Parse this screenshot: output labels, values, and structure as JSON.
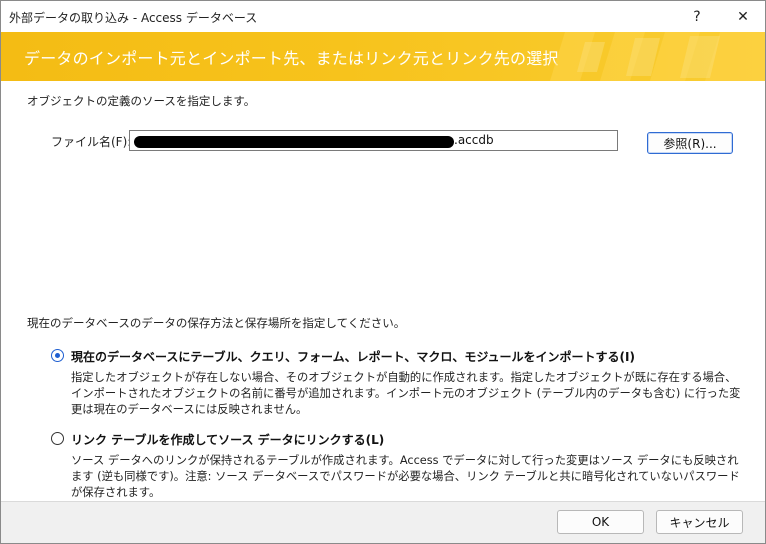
{
  "window": {
    "title": "外部データの取り込み - Access データベース",
    "help_glyph": "?",
    "close_glyph": "✕"
  },
  "banner": {
    "heading": "データのインポート元とインポート先、またはリンク元とリンク先の選択",
    "color": "#f5be17"
  },
  "source": {
    "instruction": "オブジェクトの定義のソースを指定します。",
    "file_label": "ファイル名(F):",
    "file_value_visible_suffix": ".accdb",
    "browse_label": "参照(R)..."
  },
  "storage": {
    "instruction": "現在のデータベースのデータの保存方法と保存場所を指定してください。",
    "options": [
      {
        "label": "現在のデータベースにテーブル、クエリ、フォーム、レポート、マクロ、モジュールをインポートする(I)",
        "description": "指定したオブジェクトが存在しない場合、そのオブジェクトが自動的に作成されます。指定したオブジェクトが既に存在する場合、インポートされたオブジェクトの名前に番号が追加されます。インポート元のオブジェクト (テーブル内のデータも含む) に行った変更は現在のデータベースには反映されません。",
        "selected": true
      },
      {
        "label": "リンク テーブルを作成してソース データにリンクする(L)",
        "description": "ソース データへのリンクが保持されるテーブルが作成されます。Access でデータに対して行った変更はソース データにも反映されます (逆も同様です)。注意: ソース データベースでパスワードが必要な場合、リンク テーブルと共に暗号化されていないパスワードが保存されます。",
        "selected": false
      }
    ]
  },
  "footer": {
    "ok_label": "OK",
    "cancel_label": "キャンセル"
  }
}
